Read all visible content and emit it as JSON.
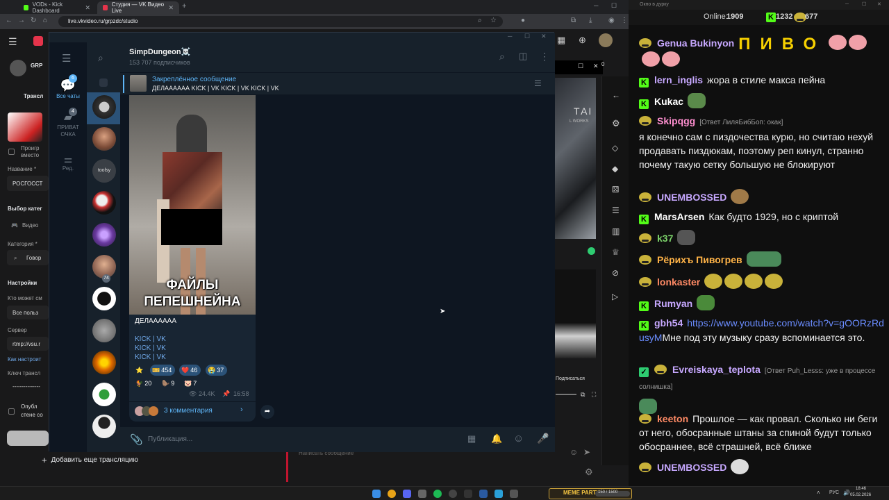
{
  "browser": {
    "tabs": [
      {
        "title": "VODs - Kick Dashboard",
        "color": "#53fc18"
      },
      {
        "title": "Студия — VK Видео Live",
        "color": "#e5344b"
      }
    ],
    "new_tab": "+",
    "url": "live.vkvideo.ru/grpzdc/studio"
  },
  "studio": {
    "left_labels": [
      "GRP",
      "Трансл",
      "Проигр",
      "вместо",
      "Название *",
      "РОСГОССТ",
      "Выбор катег",
      "Видео",
      "Категория *",
      "Говор",
      "Настройки",
      "Кто может см",
      "Все польз",
      "Сервер",
      "rtmp://vsu.r",
      "Как настроит",
      "Ключ трансл",
      "---------------",
      "Опубл",
      "стене со"
    ],
    "add_broadcast": "Добавить еще трансляцию",
    "chat_placeholder": "Написать сообщение",
    "subscribe": "Подписаться",
    "right_tiny": [
      "0",
      "ТАI",
      "L WORKS"
    ]
  },
  "telegram": {
    "folders": [
      {
        "label": "Все чаты",
        "badge": "6",
        "icon": "chat-bubble-icon"
      },
      {
        "label": "ПРИВАТ ОЧКА",
        "badge": "4",
        "icon": "chat-bubble-icon"
      },
      {
        "label": "Ред.",
        "badge": "",
        "icon": "sliders-icon"
      }
    ],
    "chatlist_badge": "74",
    "chat_avatar_text": "toolsy",
    "channel_name": "SimpDungeon☠️",
    "subscribers": "153 707 подписчиков",
    "pinned": {
      "title": "Закреплённое сообщение",
      "text": "ДЕЛАААААА  KICK | VK KICK | VK KICK | VK"
    },
    "post": {
      "image_caption": "ФАЙЛЫ ПЕПЕШНЕЙНА",
      "text": "ДЕЛАААААА",
      "links": [
        "KICK | VK",
        "KICK | VK",
        "KICK | VK"
      ],
      "reactions": [
        {
          "emoji": "⭐",
          "count": ""
        },
        {
          "emoji": "🎫",
          "count": "454"
        },
        {
          "emoji": "❤️",
          "count": "46"
        },
        {
          "emoji": "😭",
          "count": "37"
        },
        {
          "emoji": "🐓",
          "count": "20"
        },
        {
          "emoji": "🦫",
          "count": "9"
        },
        {
          "emoji": "🐷",
          "count": "7"
        }
      ],
      "views": "24.4K",
      "time": "16:58",
      "comments": "3 комментария"
    },
    "compose_placeholder": "Публикация..."
  },
  "chat": {
    "window_title": "Окно в дурку",
    "online_label": "Online:",
    "online_count": "1909",
    "kick_count": "1232",
    "vk_count": "677",
    "messages": [
      {
        "platform": "vk",
        "nick": "Genua Bukinyon",
        "color": "#c7a8ff",
        "text": "ПИВО",
        "big": true
      },
      {
        "platform": "kick",
        "nick": "lern_inglis",
        "color": "#c7a8ff",
        "text": "жора в стиле макса пейна"
      },
      {
        "platform": "kick",
        "nick": "Kukac",
        "color": "#ffffff",
        "text": ""
      },
      {
        "platform": "vk",
        "nick": "Skipqgg",
        "color": "#ff8fd0",
        "reply": "[Ответ ЛиляБибБоп: окак]",
        "text": "я конечно сам с пиздочества курю, но считаю нехуй продавать пиздюкам, поэтому реп кинул, странно почему такую сетку большую не блокируют"
      },
      {
        "platform": "vk",
        "nick": "UNEMBOSSED",
        "color": "#c7a8ff",
        "text": ""
      },
      {
        "platform": "kick",
        "nick": "MarsArsen",
        "color": "#ffffff",
        "text": "Как будто 1929, но с криптой"
      },
      {
        "platform": "vk",
        "nick": "k37",
        "color": "#7cd36a",
        "text": ""
      },
      {
        "platform": "vk",
        "nick": "Рёрихъ Пивогрев",
        "color": "#ffb347",
        "text": ""
      },
      {
        "platform": "vk",
        "nick": "lonkaster",
        "color": "#ff8a65",
        "text": ""
      },
      {
        "platform": "kick",
        "nick": "Rumyan",
        "color": "#c7a8ff",
        "text": ""
      },
      {
        "platform": "kick",
        "nick": "gbh54",
        "color": "#c7a8ff",
        "link": "https://www.youtube.com/watch?v=gOORzRdusyM",
        "text": "Мне под эту музыку сразу вспоминается это."
      },
      {
        "platform": "vk",
        "nick": "Evreiskaya_teplota",
        "color": "#c7a8ff",
        "reply": "[Ответ Puh_Lesss: уже в процессе солнишка]",
        "text": ""
      },
      {
        "platform": "vk",
        "nick": "keeton",
        "color": "#ff8a65",
        "text": "Прошлое — как провал. Сколько ни беги от него, обосранные штаны за спиной будут только обосраннее, всё страшней, всё ближе"
      },
      {
        "platform": "vk",
        "nick": "UNEMBOSSED",
        "color": "#c7a8ff",
        "text": ""
      }
    ]
  },
  "taskbar": {
    "widget": "MEME PARTY",
    "widget_progress": "150 / 1500",
    "lang": "РУС",
    "time": "18:46",
    "date": "05.02.2026"
  }
}
